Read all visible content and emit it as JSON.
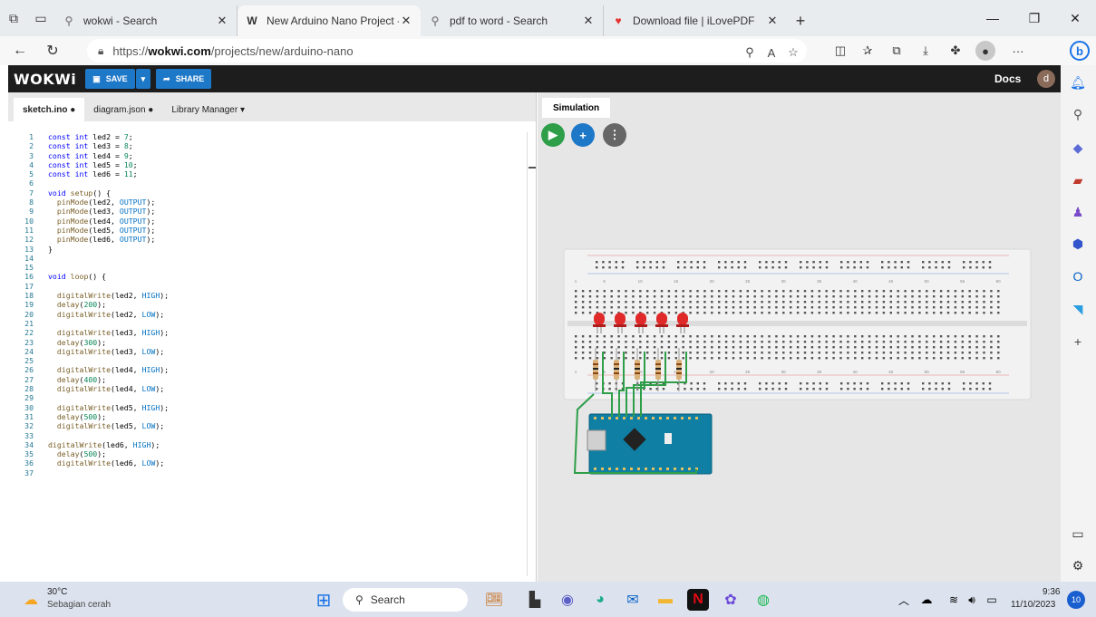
{
  "browser": {
    "tabs": [
      {
        "title": "wokwi - Search",
        "icon": "search-icon"
      },
      {
        "title": "New Arduino Nano Project - Wo",
        "icon": "wokwi-icon"
      },
      {
        "title": "pdf to word - Search",
        "icon": "search-icon"
      },
      {
        "title": "Download file | iLovePDF",
        "icon": "heart-icon"
      }
    ],
    "url_prefix": "https://",
    "url_domain": "wokwi.com",
    "url_path": "/projects/new/arduino-nano"
  },
  "wokwi": {
    "logo": "WOKWi",
    "save_label": "SAVE",
    "share_label": "SHARE",
    "docs_label": "Docs",
    "avatar_letter": "d"
  },
  "editor": {
    "tabs": [
      {
        "label": "sketch.ino ●"
      },
      {
        "label": "diagram.json ●"
      },
      {
        "label": "Library Manager ▾"
      }
    ],
    "lines": [
      [
        {
          "t": "const int ",
          "c": "kw"
        },
        {
          "t": "led2 = ",
          "c": "ct"
        },
        {
          "t": "7",
          "c": "num"
        },
        {
          "t": ";",
          "c": "ct"
        }
      ],
      [
        {
          "t": "const int ",
          "c": "kw"
        },
        {
          "t": "led3 = ",
          "c": "ct"
        },
        {
          "t": "8",
          "c": "num"
        },
        {
          "t": ";",
          "c": "ct"
        }
      ],
      [
        {
          "t": "const int ",
          "c": "kw"
        },
        {
          "t": "led4 = ",
          "c": "ct"
        },
        {
          "t": "9",
          "c": "num"
        },
        {
          "t": ";",
          "c": "ct"
        }
      ],
      [
        {
          "t": "const int ",
          "c": "kw"
        },
        {
          "t": "led5 = ",
          "c": "ct"
        },
        {
          "t": "10",
          "c": "num"
        },
        {
          "t": ";",
          "c": "ct"
        }
      ],
      [
        {
          "t": "const int ",
          "c": "kw"
        },
        {
          "t": "led6 = ",
          "c": "ct"
        },
        {
          "t": "11",
          "c": "num"
        },
        {
          "t": ";",
          "c": "ct"
        }
      ],
      [],
      [
        {
          "t": "void ",
          "c": "kw"
        },
        {
          "t": "setup",
          "c": "fn"
        },
        {
          "t": "() {",
          "c": "ct"
        }
      ],
      [
        {
          "t": "  pinMode",
          "c": "fn"
        },
        {
          "t": "(led2, ",
          "c": "ct"
        },
        {
          "t": "OUTPUT",
          "c": "cst"
        },
        {
          "t": ");",
          "c": "ct"
        }
      ],
      [
        {
          "t": "  pinMode",
          "c": "fn"
        },
        {
          "t": "(led3, ",
          "c": "ct"
        },
        {
          "t": "OUTPUT",
          "c": "cst"
        },
        {
          "t": ");",
          "c": "ct"
        }
      ],
      [
        {
          "t": "  pinMode",
          "c": "fn"
        },
        {
          "t": "(led4, ",
          "c": "ct"
        },
        {
          "t": "OUTPUT",
          "c": "cst"
        },
        {
          "t": ");",
          "c": "ct"
        }
      ],
      [
        {
          "t": "  pinMode",
          "c": "fn"
        },
        {
          "t": "(led5, ",
          "c": "ct"
        },
        {
          "t": "OUTPUT",
          "c": "cst"
        },
        {
          "t": ");",
          "c": "ct"
        }
      ],
      [
        {
          "t": "  pinMode",
          "c": "fn"
        },
        {
          "t": "(led6, ",
          "c": "ct"
        },
        {
          "t": "OUTPUT",
          "c": "cst"
        },
        {
          "t": ");",
          "c": "ct"
        }
      ],
      [
        {
          "t": "}",
          "c": "ct"
        }
      ],
      [],
      [],
      [
        {
          "t": "void ",
          "c": "kw"
        },
        {
          "t": "loop",
          "c": "fn"
        },
        {
          "t": "() {",
          "c": "ct"
        }
      ],
      [],
      [
        {
          "t": "  digitalWrite",
          "c": "fn"
        },
        {
          "t": "(led2, ",
          "c": "ct"
        },
        {
          "t": "HIGH",
          "c": "cst"
        },
        {
          "t": ");",
          "c": "ct"
        }
      ],
      [
        {
          "t": "  delay",
          "c": "fn"
        },
        {
          "t": "(",
          "c": "ct"
        },
        {
          "t": "200",
          "c": "num"
        },
        {
          "t": ");",
          "c": "ct"
        }
      ],
      [
        {
          "t": "  digitalWrite",
          "c": "fn"
        },
        {
          "t": "(led2, ",
          "c": "ct"
        },
        {
          "t": "LOW",
          "c": "cst"
        },
        {
          "t": ");",
          "c": "ct"
        }
      ],
      [],
      [
        {
          "t": "  digitalWrite",
          "c": "fn"
        },
        {
          "t": "(led3, ",
          "c": "ct"
        },
        {
          "t": "HIGH",
          "c": "cst"
        },
        {
          "t": ");",
          "c": "ct"
        }
      ],
      [
        {
          "t": "  delay",
          "c": "fn"
        },
        {
          "t": "(",
          "c": "ct"
        },
        {
          "t": "300",
          "c": "num"
        },
        {
          "t": ");",
          "c": "ct"
        }
      ],
      [
        {
          "t": "  digitalWrite",
          "c": "fn"
        },
        {
          "t": "(led3, ",
          "c": "ct"
        },
        {
          "t": "LOW",
          "c": "cst"
        },
        {
          "t": ");",
          "c": "ct"
        }
      ],
      [],
      [
        {
          "t": "  digitalWrite",
          "c": "fn"
        },
        {
          "t": "(led4, ",
          "c": "ct"
        },
        {
          "t": "HIGH",
          "c": "cst"
        },
        {
          "t": ");",
          "c": "ct"
        }
      ],
      [
        {
          "t": "  delay",
          "c": "fn"
        },
        {
          "t": "(",
          "c": "ct"
        },
        {
          "t": "400",
          "c": "num"
        },
        {
          "t": ");",
          "c": "ct"
        }
      ],
      [
        {
          "t": "  digitalWrite",
          "c": "fn"
        },
        {
          "t": "(led4, ",
          "c": "ct"
        },
        {
          "t": "LOW",
          "c": "cst"
        },
        {
          "t": ");",
          "c": "ct"
        }
      ],
      [],
      [
        {
          "t": "  digitalWrite",
          "c": "fn"
        },
        {
          "t": "(led5, ",
          "c": "ct"
        },
        {
          "t": "HIGH",
          "c": "cst"
        },
        {
          "t": ");",
          "c": "ct"
        }
      ],
      [
        {
          "t": "  delay",
          "c": "fn"
        },
        {
          "t": "(",
          "c": "ct"
        },
        {
          "t": "500",
          "c": "num"
        },
        {
          "t": ");",
          "c": "ct"
        }
      ],
      [
        {
          "t": "  digitalWrite",
          "c": "fn"
        },
        {
          "t": "(led5, ",
          "c": "ct"
        },
        {
          "t": "LOW",
          "c": "cst"
        },
        {
          "t": ");",
          "c": "ct"
        }
      ],
      [],
      [
        {
          "t": "digitalWrite",
          "c": "fn"
        },
        {
          "t": "(led6, ",
          "c": "ct"
        },
        {
          "t": "HIGH",
          "c": "cst"
        },
        {
          "t": ");",
          "c": "ct"
        }
      ],
      [
        {
          "t": "  delay",
          "c": "fn"
        },
        {
          "t": "(",
          "c": "ct"
        },
        {
          "t": "500",
          "c": "num"
        },
        {
          "t": ");",
          "c": "ct"
        }
      ],
      [
        {
          "t": "  digitalWrite",
          "c": "fn"
        },
        {
          "t": "(led6, ",
          "c": "ct"
        },
        {
          "t": "LOW",
          "c": "cst"
        },
        {
          "t": ");",
          "c": "ct"
        }
      ],
      []
    ]
  },
  "simulation": {
    "tab_label": "Simulation",
    "breadboard_col_labels": [
      "1",
      "5",
      "10",
      "15",
      "20",
      "25",
      "30",
      "35",
      "40",
      "45",
      "50",
      "55",
      "60"
    ],
    "led_count": 5
  },
  "taskbar": {
    "weather_temp": "30°C",
    "weather_desc": "Sebagian cerah",
    "search_label": "Search",
    "time": "9:36",
    "date": "11/10/2023",
    "notifications": "10"
  },
  "colors": {
    "wokwi_blue": "#1e78c8",
    "run_green": "#2e9e48",
    "add_blue": "#1e78c8",
    "menu_gray": "#666666",
    "led_red": "#e02a2a"
  }
}
